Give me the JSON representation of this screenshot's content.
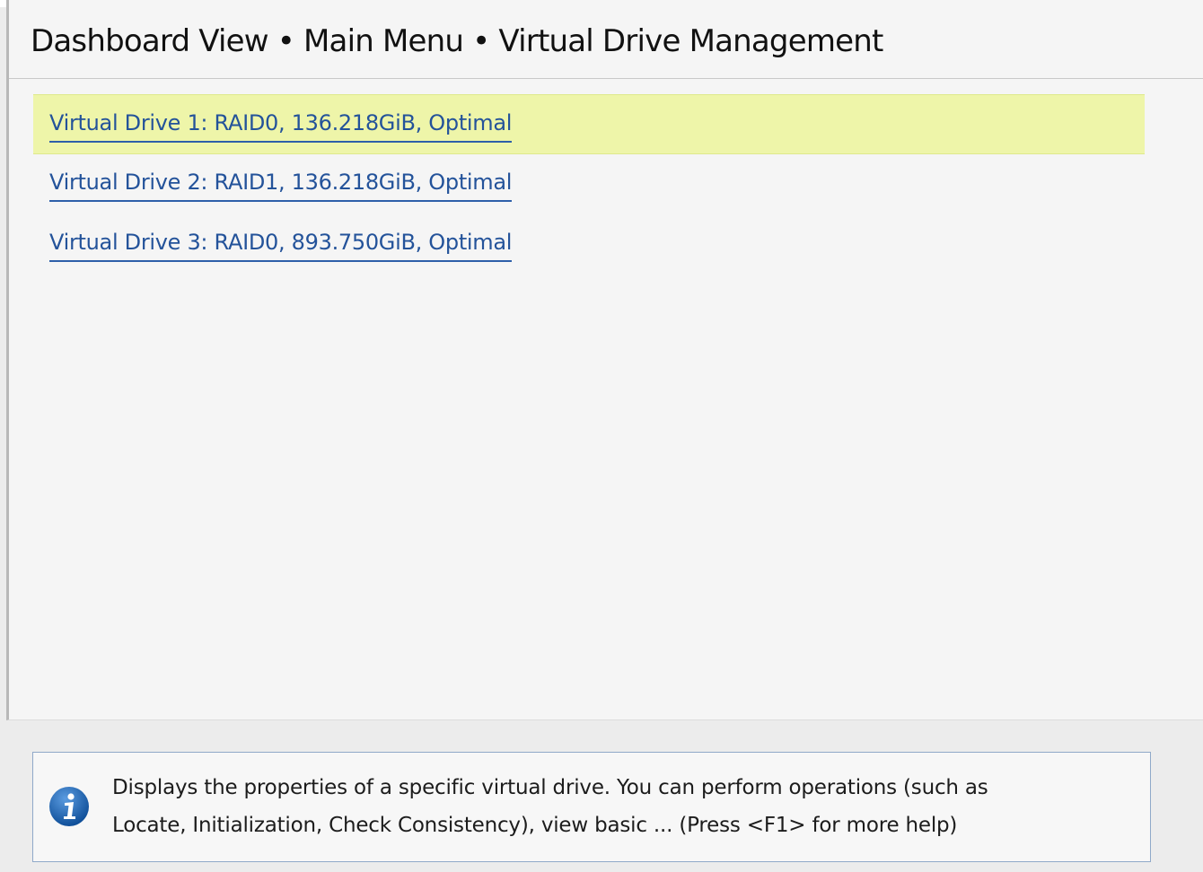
{
  "header": {
    "breadcrumb": "Dashboard View • Main Menu • Virtual Drive Management"
  },
  "drives": [
    {
      "label": "Virtual Drive 1: RAID0, 136.218GiB, Optimal",
      "selected": true
    },
    {
      "label": "Virtual Drive 2: RAID1, 136.218GiB, Optimal",
      "selected": false
    },
    {
      "label": "Virtual Drive 3: RAID0, 893.750GiB, Optimal",
      "selected": false
    }
  ],
  "help": {
    "icon": "info-icon",
    "text_line1": "Displays the properties of a specific virtual drive. You can perform operations (such as",
    "text_line2": "Locate, Initialization, Check Consistency), view basic ... (Press <F1> for more help)"
  },
  "colors": {
    "selected_highlight": "#eef5a9",
    "link": "#24539a",
    "info_icon": "#1b63b3"
  }
}
